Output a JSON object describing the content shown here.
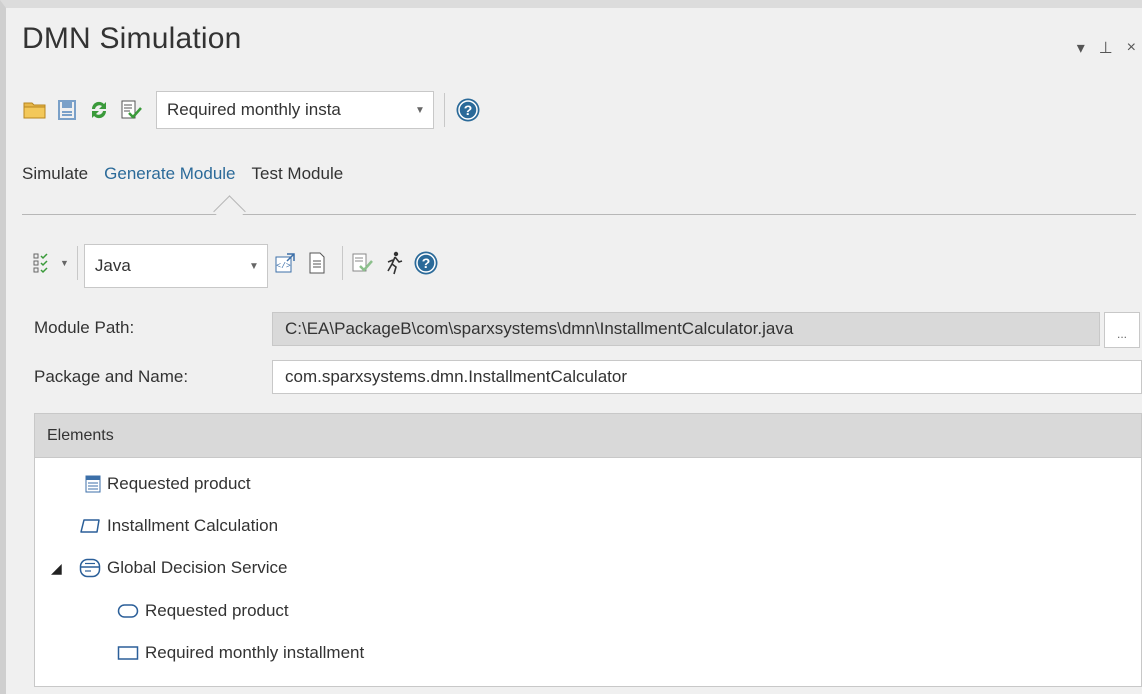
{
  "window": {
    "title": "DMN Simulation",
    "controls": {
      "dropdown": "▾",
      "pin": "⊥",
      "close": "×"
    }
  },
  "toolbar": {
    "combo_value": "Required monthly insta",
    "help": "?"
  },
  "tabs": [
    {
      "label": "Simulate"
    },
    {
      "label": "Generate Module"
    },
    {
      "label": "Test Module"
    }
  ],
  "generate": {
    "language_value": "Java",
    "help": "?"
  },
  "form": {
    "module_path_label": "Module Path:",
    "module_path_value": "C:\\EA\\PackageB\\com\\sparxsystems\\dmn\\InstallmentCalculator.java",
    "browse_label": "...",
    "package_label": "Package and Name:",
    "package_value": "com.sparxsystems.dmn.InstallmentCalculator"
  },
  "elements": {
    "header": "Elements",
    "items": [
      {
        "label": "Requested product",
        "icon": "table-icon"
      },
      {
        "label": "Installment Calculation",
        "icon": "rounded-rect-icon"
      },
      {
        "label": "Global Decision Service",
        "icon": "decision-service-icon"
      },
      {
        "label": "Requested product",
        "icon": "oval-icon"
      },
      {
        "label": "Required monthly installment",
        "icon": "rect-icon"
      }
    ],
    "expander": "◢"
  },
  "colors": {
    "accent": "#2b6a99",
    "panel_bg": "#f0f0f0",
    "header_bg": "#d9d9d9"
  }
}
